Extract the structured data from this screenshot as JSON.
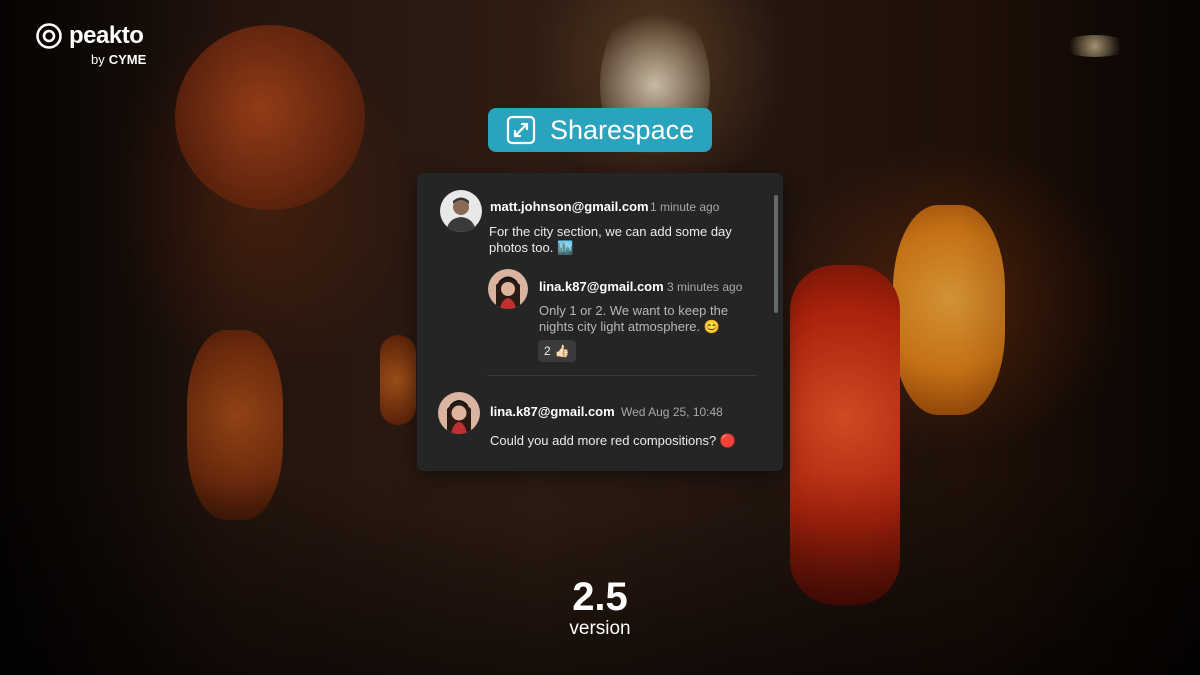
{
  "brand": {
    "name": "peakto",
    "by": "by",
    "company": "CYME"
  },
  "badge": {
    "label": "Sharespace",
    "icon": "share-arrows-icon",
    "color": "#2aa3bd"
  },
  "comments": [
    {
      "author": "matt.johnson@gmail.com",
      "time": "1 minute ago",
      "text": "For the city section, we can add some day photos too. 🏙️",
      "reply": {
        "author": "lina.k87@gmail.com",
        "time": "3 minutes ago",
        "text": "Only 1 or 2. We want to keep the nights city light atmosphere. 😊",
        "reaction": {
          "count": "2",
          "emoji": "👍🏻"
        }
      }
    },
    {
      "author": "lina.k87@gmail.com",
      "time": "Wed Aug 25, 10:48",
      "text": "Could you add more red compositions? 🔴"
    }
  ],
  "version": {
    "number": "2.5",
    "label": "version"
  }
}
